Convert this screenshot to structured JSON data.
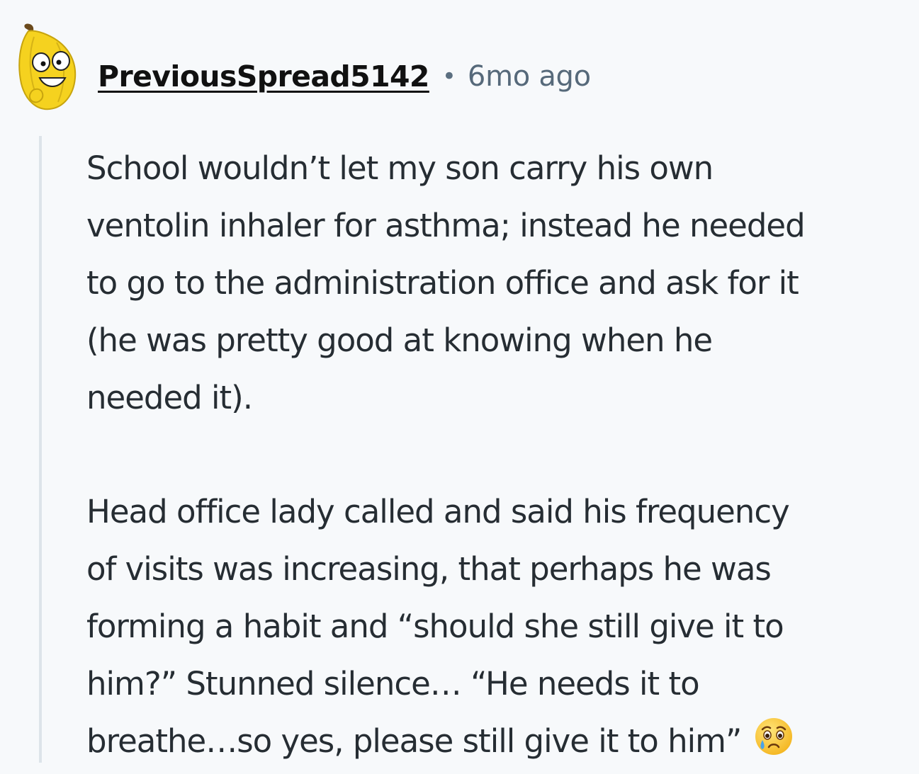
{
  "comment": {
    "author": "PreviousSpread5142",
    "separator": "•",
    "timestamp": "6mo ago",
    "avatar_icon": "banana-avatar-icon",
    "paragraphs": [
      {
        "lines": [
          "School wouldn’t let my son carry his own",
          "ventolin inhaler for asthma; instead he needed",
          "to go to the administration office and ask for it",
          "(he was pretty good at knowing when he",
          "needed it)."
        ]
      },
      {
        "lines": [
          "Head office lady called and said his frequency",
          "of visits was increasing, that perhaps he was",
          "forming a habit and “should she still give it to",
          "him?” Stunned silence… “He needs it to",
          "breathe…so yes, please still give it to him”"
        ],
        "trailing_emoji": "sad-tear-face-emoji-icon"
      }
    ]
  },
  "colors": {
    "background": "#f7f9fb",
    "username": "#111111",
    "meta": "#56697a",
    "body_text": "#262d33",
    "thread_line": "#dde4ea",
    "avatar_yellow": "#f5d21f"
  }
}
